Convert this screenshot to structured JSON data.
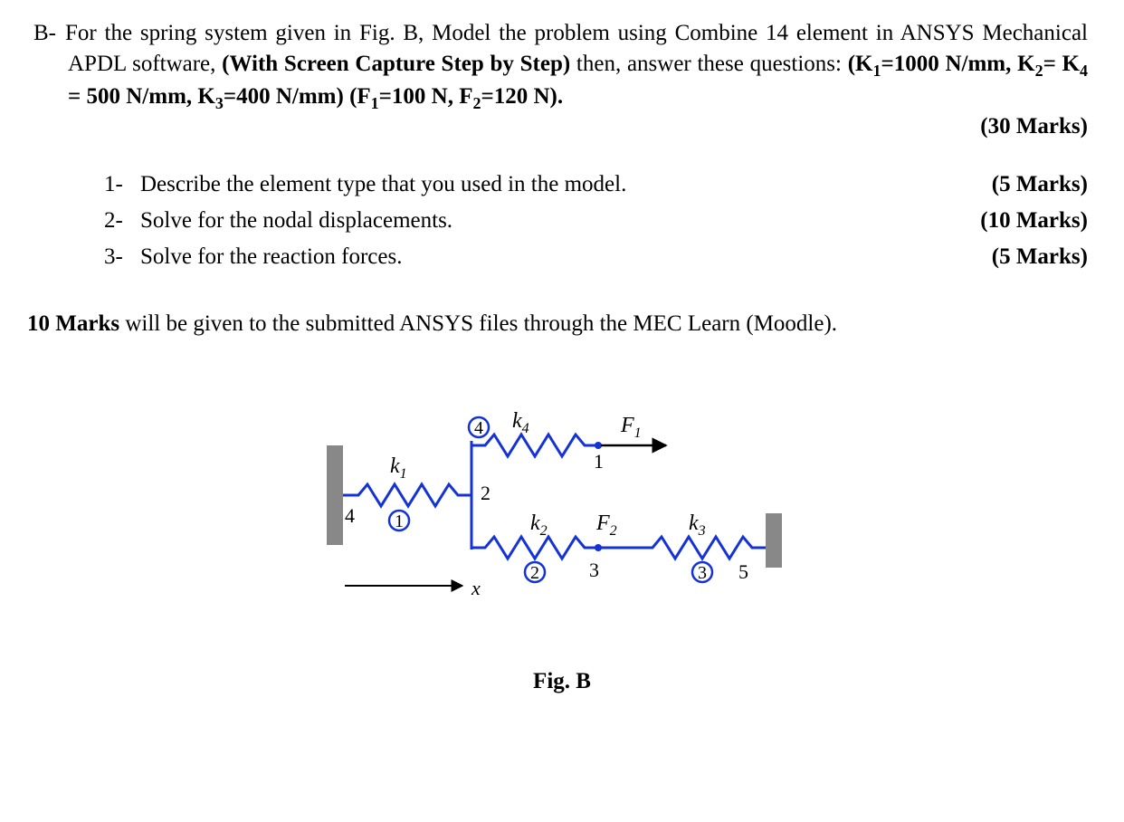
{
  "problem": {
    "label": "B-",
    "intro_segments": {
      "s1": "For the spring system given in Fig. B, Model the problem using Combine 14 element in ANSYS Mechanical APDL software, ",
      "s2_bold": "(With Screen Capture Step by Step)",
      "s3": " then, answer these questions: ",
      "s4_bold_a": "(K",
      "s4_sub_1": "1",
      "s4_bold_b": "=1000 N/mm, K",
      "s4_sub_2": "2",
      "s4_bold_c": "= K",
      "s4_sub_4": "4",
      "s4_bold_d": " = 500 N/mm, K",
      "s4_sub_3": "3",
      "s4_bold_e": "=400 N/mm) (F",
      "s4_sub_f1": "1",
      "s4_bold_f": "=100 N, F",
      "s4_sub_f2": "2",
      "s4_bold_g": "=120 N)."
    },
    "total_marks": "(30 Marks)"
  },
  "questions": [
    {
      "num": "1-",
      "text": "Describe the element type that you used in the model.",
      "marks": "(5 Marks)"
    },
    {
      "num": "2-",
      "text": "Solve for the nodal displacements.",
      "marks": "(10 Marks)"
    },
    {
      "num": "3-",
      "text": "Solve for the reaction forces.",
      "marks": "(5 Marks)"
    }
  ],
  "note": {
    "lead_bold": "10 Marks",
    "rest": " will be given to the submitted ANSYS files through the MEC Learn (Moodle)."
  },
  "figure": {
    "caption": "Fig. B",
    "labels": {
      "k1": "k",
      "k1_sub": "1",
      "k2": "k",
      "k2_sub": "2",
      "k3": "k",
      "k3_sub": "3",
      "k4": "k",
      "k4_sub": "4",
      "F1": "F",
      "F1_sub": "1",
      "F2": "F",
      "F2_sub": "2",
      "x": "x",
      "node1": "1",
      "node2": "2",
      "node3": "3",
      "node4": "4",
      "node5": "5",
      "elem1": "1",
      "elem2": "2",
      "elem3": "3",
      "elem4": "4"
    }
  }
}
